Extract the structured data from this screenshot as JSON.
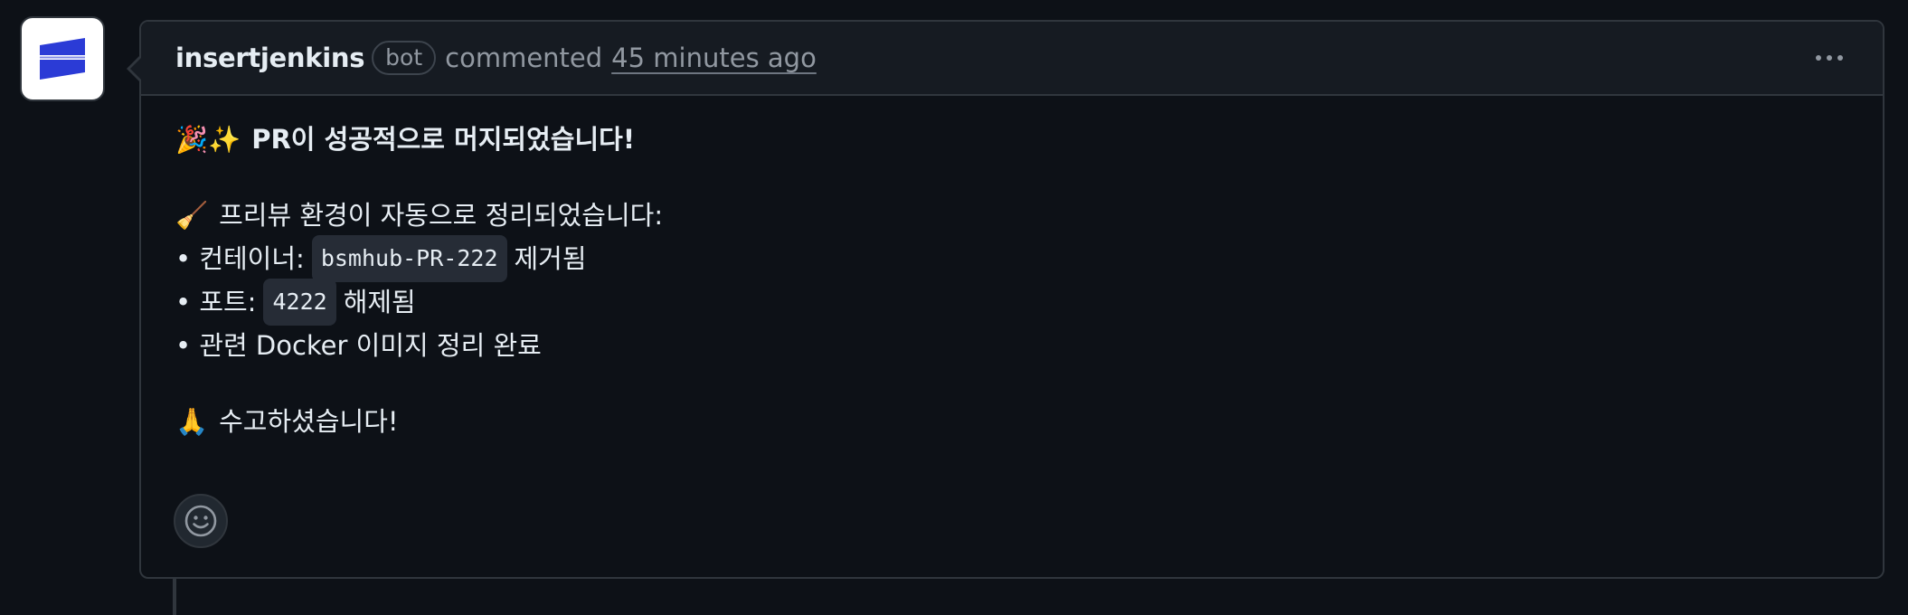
{
  "comment": {
    "author": "insertjenkins",
    "badge": "bot",
    "action": "commented",
    "timestamp": "45 minutes ago"
  },
  "body": {
    "title_emoji": "🎉✨",
    "title": "PR이 성공적으로 머지되었습니다!",
    "cleanup_emoji": "🧹",
    "cleanup_intro": "프리뷰 환경이 자동으로 정리되었습니다:",
    "items": [
      {
        "prefix": "• 컨테이너:",
        "code": "bsmhub-PR-222",
        "suffix": "제거됨"
      },
      {
        "prefix": "• 포트:",
        "code": "4222",
        "suffix": "해제됨"
      },
      {
        "text": "• 관련 Docker 이미지 정리 완료"
      }
    ],
    "thanks_emoji": "🙏",
    "thanks": "수고하셨습니다!"
  },
  "colors": {
    "background": "#0d1117",
    "header_bg": "#161b22",
    "border": "#30363d",
    "muted_text": "#9198a1",
    "code_bg": "#262c36",
    "avatar_logo": "#2b3bd6"
  },
  "icons": {
    "avatar": "insertjenkins-logo",
    "menu": "kebab-horizontal-icon",
    "reaction": "smiley-icon"
  }
}
